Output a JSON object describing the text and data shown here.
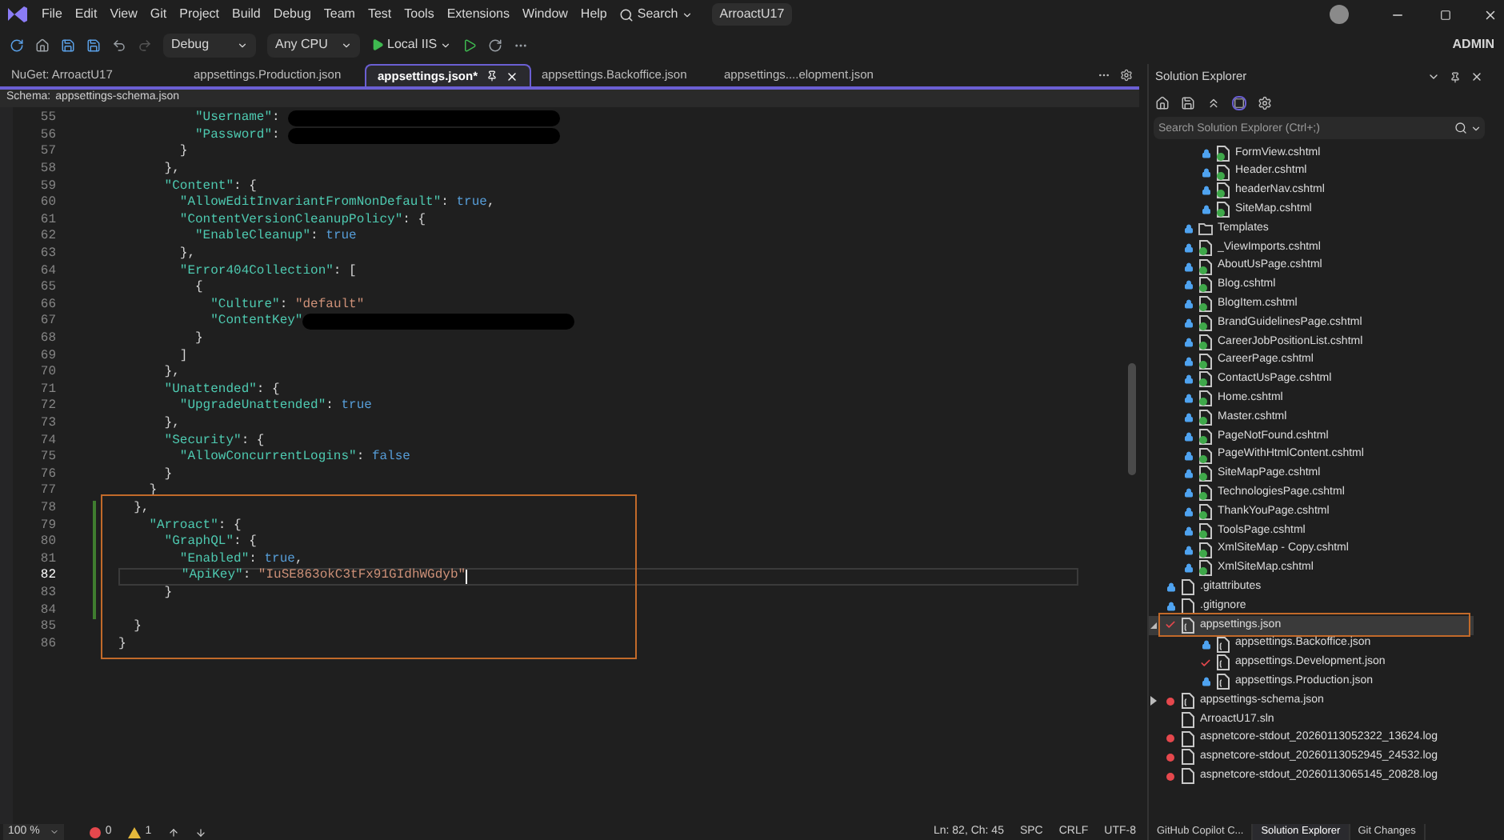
{
  "menu": {
    "items": [
      "File",
      "Edit",
      "View",
      "Git",
      "Project",
      "Build",
      "Debug",
      "Team",
      "Test",
      "Tools",
      "Extensions",
      "Window",
      "Help"
    ],
    "search": "Search",
    "solution_badge": "ArroactU17"
  },
  "toolbar": {
    "configuration": "Debug",
    "platform": "Any CPU",
    "run_target": "Local IIS",
    "account": "ADMIN"
  },
  "editor_tabs": [
    {
      "label": "NuGet: ArroactU17",
      "selected": false
    },
    {
      "label": "appsettings.Production.json",
      "selected": false
    },
    {
      "label": "appsettings.json*",
      "selected": true
    },
    {
      "label": "appsettings.Backoffice.json",
      "selected": false
    },
    {
      "label": "appsettings....elopment.json",
      "selected": false
    }
  ],
  "schema_bar": {
    "label": "Schema:",
    "value": "appsettings-schema.json"
  },
  "code": {
    "lines": [
      {
        "number": "55",
        "tokens": [
          {
            "kind": "key",
            "text": "          \"Username\""
          },
          {
            "kind": "punct",
            "text": ": "
          }
        ],
        "redacted": true
      },
      {
        "number": "56",
        "tokens": [
          {
            "kind": "key",
            "text": "          \"Password\""
          },
          {
            "kind": "punct",
            "text": ": "
          }
        ],
        "redacted": true
      },
      {
        "number": "57",
        "tokens": [
          {
            "kind": "punct",
            "text": "        }"
          }
        ]
      },
      {
        "number": "58",
        "tokens": [
          {
            "kind": "punct",
            "text": "      },"
          }
        ]
      },
      {
        "number": "59",
        "tokens": [
          {
            "kind": "key",
            "text": "      \"Content\""
          },
          {
            "kind": "punct",
            "text": ": {"
          }
        ]
      },
      {
        "number": "60",
        "tokens": [
          {
            "kind": "key",
            "text": "        \"AllowEditInvariantFromNonDefault\""
          },
          {
            "kind": "punct",
            "text": ": "
          },
          {
            "kind": "bool",
            "text": "true"
          },
          {
            "kind": "punct",
            "text": ","
          }
        ]
      },
      {
        "number": "61",
        "tokens": [
          {
            "kind": "key",
            "text": "        \"ContentVersionCleanupPolicy\""
          },
          {
            "kind": "punct",
            "text": ": {"
          }
        ]
      },
      {
        "number": "62",
        "tokens": [
          {
            "kind": "key",
            "text": "          \"EnableCleanup\""
          },
          {
            "kind": "punct",
            "text": ": "
          },
          {
            "kind": "bool",
            "text": "true"
          }
        ]
      },
      {
        "number": "63",
        "tokens": [
          {
            "kind": "punct",
            "text": "        },"
          }
        ]
      },
      {
        "number": "64",
        "tokens": [
          {
            "kind": "key",
            "text": "        \"Error404Collection\""
          },
          {
            "kind": "punct",
            "text": ": ["
          }
        ]
      },
      {
        "number": "65",
        "tokens": [
          {
            "kind": "punct",
            "text": "          {"
          }
        ]
      },
      {
        "number": "66",
        "tokens": [
          {
            "kind": "key",
            "text": "            \"Culture\""
          },
          {
            "kind": "punct",
            "text": ": "
          },
          {
            "kind": "str",
            "text": "\"default\""
          }
        ]
      },
      {
        "number": "67",
        "tokens": [
          {
            "kind": "key",
            "text": "            \"ContentKey\""
          }
        ],
        "redacted": true
      },
      {
        "number": "68",
        "tokens": [
          {
            "kind": "punct",
            "text": "          }"
          }
        ]
      },
      {
        "number": "69",
        "tokens": [
          {
            "kind": "punct",
            "text": "        ]"
          }
        ]
      },
      {
        "number": "70",
        "tokens": [
          {
            "kind": "punct",
            "text": "      },"
          }
        ]
      },
      {
        "number": "71",
        "tokens": [
          {
            "kind": "key",
            "text": "      \"Unattended\""
          },
          {
            "kind": "punct",
            "text": ": {"
          }
        ]
      },
      {
        "number": "72",
        "tokens": [
          {
            "kind": "key",
            "text": "        \"UpgradeUnattended\""
          },
          {
            "kind": "punct",
            "text": ": "
          },
          {
            "kind": "bool",
            "text": "true"
          }
        ]
      },
      {
        "number": "73",
        "tokens": [
          {
            "kind": "punct",
            "text": "      },"
          }
        ]
      },
      {
        "number": "74",
        "tokens": [
          {
            "kind": "key",
            "text": "      \"Security\""
          },
          {
            "kind": "punct",
            "text": ": {"
          }
        ]
      },
      {
        "number": "75",
        "tokens": [
          {
            "kind": "key",
            "text": "        \"AllowConcurrentLogins\""
          },
          {
            "kind": "punct",
            "text": ": "
          },
          {
            "kind": "bool",
            "text": "false"
          }
        ]
      },
      {
        "number": "76",
        "tokens": [
          {
            "kind": "punct",
            "text": "      }"
          }
        ]
      },
      {
        "number": "77",
        "tokens": [
          {
            "kind": "punct",
            "text": "    }"
          }
        ]
      },
      {
        "number": "78",
        "tokens": [
          {
            "kind": "punct",
            "text": "  },"
          }
        ],
        "changed": true,
        "annotated": true
      },
      {
        "number": "79",
        "tokens": [
          {
            "kind": "key",
            "text": "    \"Arroact\""
          },
          {
            "kind": "punct",
            "text": ": {"
          }
        ],
        "changed": true,
        "annotated": true
      },
      {
        "number": "80",
        "tokens": [
          {
            "kind": "key",
            "text": "      \"GraphQL\""
          },
          {
            "kind": "punct",
            "text": ": {"
          }
        ],
        "changed": true,
        "annotated": true
      },
      {
        "number": "81",
        "tokens": [
          {
            "kind": "key",
            "text": "        \"Enabled\""
          },
          {
            "kind": "punct",
            "text": ": "
          },
          {
            "kind": "bool",
            "text": "true"
          },
          {
            "kind": "punct",
            "text": ","
          }
        ],
        "changed": true,
        "annotated": true
      },
      {
        "number": "82",
        "tokens": [
          {
            "kind": "key",
            "text": "        \"ApiKey\""
          },
          {
            "kind": "punct",
            "text": ": "
          },
          {
            "kind": "str",
            "text": "\"IuSE863okC3tFx91GIdhWGdyb\""
          }
        ],
        "changed": true,
        "annotated": true,
        "current": true
      },
      {
        "number": "83",
        "tokens": [
          {
            "kind": "punct",
            "text": "      }"
          }
        ],
        "changed": true,
        "annotated": true
      },
      {
        "number": "84",
        "changed": true,
        "annotated": true
      },
      {
        "number": "85",
        "tokens": [
          {
            "kind": "punct",
            "text": "  }"
          }
        ],
        "annotated": true
      },
      {
        "number": "86",
        "tokens": [
          {
            "kind": "punct",
            "text": "}"
          }
        ],
        "annotated": true
      }
    ]
  },
  "status_bar": {
    "zoom": "100 %",
    "errors": "0",
    "warnings": "1",
    "position": "Ln: 82, Ch: 45",
    "indent": "SPC",
    "line_endings": "CRLF",
    "encoding": "UTF-8"
  },
  "solution_explorer": {
    "title": "Solution Explorer",
    "search": {
      "placeholder": "Search Solution Explorer (Ctrl+;)"
    },
    "tree": [
      {
        "children": [
          {
            "children": [
              {
                "label": "FormView.cshtml",
                "kind": "page",
                "locked": true
              },
              {
                "label": "Header.cshtml",
                "kind": "page",
                "locked": true
              },
              {
                "label": "headerNav.cshtml",
                "kind": "page",
                "locked": true
              },
              {
                "label": "SiteMap.cshtml",
                "kind": "page",
                "locked": true
              }
            ]
          },
          {
            "label": "Templates",
            "kind": "folder",
            "locked": true
          },
          {
            "label": "_ViewImports.cshtml",
            "kind": "page",
            "locked": true
          },
          {
            "label": "AboutUsPage.cshtml",
            "kind": "page",
            "locked": true
          },
          {
            "label": "Blog.cshtml",
            "kind": "page",
            "locked": true
          },
          {
            "label": "BlogItem.cshtml",
            "kind": "page",
            "locked": true
          },
          {
            "label": "BrandGuidelinesPage.cshtml",
            "kind": "page",
            "locked": true
          },
          {
            "label": "CareerJobPositionList.cshtml",
            "kind": "page",
            "locked": true
          },
          {
            "label": "CareerPage.cshtml",
            "kind": "page",
            "locked": true
          },
          {
            "label": "ContactUsPage.cshtml",
            "kind": "page",
            "locked": true
          },
          {
            "label": "Home.cshtml",
            "kind": "page",
            "locked": true
          },
          {
            "label": "Master.cshtml",
            "kind": "page",
            "locked": true
          },
          {
            "label": "PageNotFound.cshtml",
            "kind": "page",
            "locked": true
          },
          {
            "label": "PageWithHtmlContent.cshtml",
            "kind": "page",
            "locked": true
          },
          {
            "label": "SiteMapPage.cshtml",
            "kind": "page",
            "locked": true
          },
          {
            "label": "TechnologiesPage.cshtml",
            "kind": "page",
            "locked": true
          },
          {
            "label": "ThankYouPage.cshtml",
            "kind": "page",
            "locked": true
          },
          {
            "label": "ToolsPage.cshtml",
            "kind": "page",
            "locked": true
          },
          {
            "label": "XmlSiteMap - Copy.cshtml",
            "kind": "page",
            "locked": true
          },
          {
            "label": "XmlSiteMap.cshtml",
            "kind": "page",
            "locked": true
          }
        ]
      },
      {
        "label": ".gitattributes",
        "kind": "file",
        "locked": true
      },
      {
        "label": ".gitignore",
        "kind": "file",
        "locked": true
      },
      {
        "label": "appsettings.json",
        "kind": "json",
        "modified": true,
        "expanded": true,
        "selected": true,
        "annotated": true,
        "children": [
          {
            "label": "appsettings.Backoffice.json",
            "kind": "json",
            "locked": true
          },
          {
            "label": "appsettings.Development.json",
            "kind": "json",
            "modified": true
          },
          {
            "label": "appsettings.Production.json",
            "kind": "json",
            "locked": true
          }
        ]
      },
      {
        "label": "appsettings-schema.json",
        "kind": "json",
        "untracked": true,
        "expanded": false
      },
      {
        "label": "ArroactU17.sln",
        "kind": "file"
      },
      {
        "label": "aspnetcore-stdout_20260113052322_13624.log",
        "kind": "file",
        "untracked": true
      },
      {
        "label": "aspnetcore-stdout_20260113052945_24532.log",
        "kind": "file",
        "untracked": true
      },
      {
        "label": "aspnetcore-stdout_20260113065145_20828.log",
        "kind": "file",
        "untracked": true
      }
    ]
  },
  "bottom_tabs": [
    {
      "label": "GitHub Copilot C...",
      "selected": false
    },
    {
      "label": "Solution Explorer",
      "selected": true
    },
    {
      "label": "Git Changes",
      "selected": false
    }
  ]
}
